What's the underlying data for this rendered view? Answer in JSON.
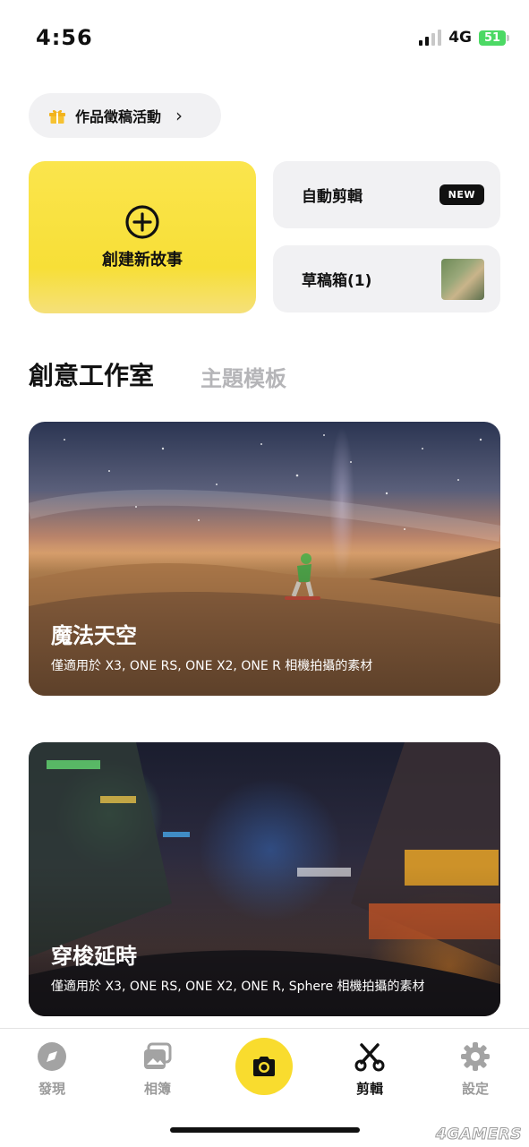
{
  "status_bar": {
    "time": "4:56",
    "network": "4G",
    "battery": "51"
  },
  "promo": {
    "label": "作品徵稿活動",
    "icon": "gift-icon"
  },
  "create": {
    "label": "創建新故事",
    "icon": "plus-circle-icon"
  },
  "auto_edit": {
    "label": "自動剪輯",
    "badge": "NEW"
  },
  "drafts": {
    "label": "草稿箱(1)"
  },
  "tabs": {
    "active": "創意工作室",
    "inactive": "主題模板"
  },
  "templates": [
    {
      "title": "魔法天空",
      "subtitle": "僅適用於 X3, ONE RS, ONE X2, ONE R 相機拍攝的素材"
    },
    {
      "title": "穿梭延時",
      "subtitle": "僅適用於 X3, ONE RS, ONE X2, ONE R, Sphere 相機拍攝的素材"
    }
  ],
  "nav": {
    "items": [
      {
        "label": "發現",
        "icon": "compass-icon"
      },
      {
        "label": "相簿",
        "icon": "album-icon"
      },
      {
        "label": "",
        "icon": "camera-icon"
      },
      {
        "label": "剪輯",
        "icon": "scissors-icon"
      },
      {
        "label": "設定",
        "icon": "gear-icon"
      }
    ],
    "active": "剪輯"
  },
  "watermark": "4GAMERS",
  "colors": {
    "accent_yellow": "#f9dc2e",
    "card_gray": "#f1f1f3",
    "inactive_gray": "#9a9a9a"
  }
}
